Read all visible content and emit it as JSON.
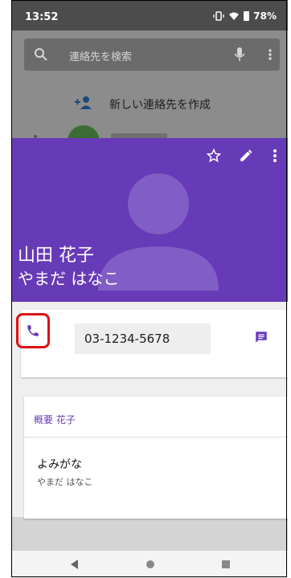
{
  "status_bar": {
    "time": "13:52",
    "battery": "78%"
  },
  "background": {
    "search_placeholder": "連絡先を検索",
    "create_contact": "新しい連絡先を作成"
  },
  "contact": {
    "name": "山田 花子",
    "name_kana": "やまだ はなこ",
    "phone_number": "03-1234-5678"
  },
  "about": {
    "title": "概要 花子",
    "field_label": "よみがな",
    "field_value": "やまだ はなこ"
  },
  "colors": {
    "header": "#673ab7",
    "accent": "#673ab7",
    "highlight": "#e01010"
  },
  "icons": {
    "header_actions": [
      "star-outline-icon",
      "edit-pencil-icon",
      "more-vert-icon"
    ],
    "phone": "phone-icon",
    "message": "message-icon",
    "nav": [
      "back-triangle-icon",
      "home-circle-icon",
      "recents-square-icon"
    ]
  }
}
